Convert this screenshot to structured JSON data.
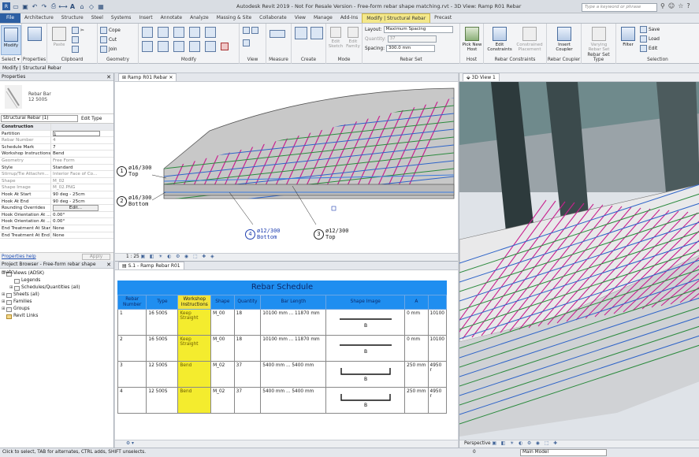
{
  "app": {
    "title": "Autodesk Revit 2019 - Not For Resale Version - Free-form rebar shape matching.rvt - 3D View: Ramp R01 Rebar",
    "search_placeholder": "Type a keyword or phrase"
  },
  "tabs": [
    "File",
    "Architecture",
    "Structure",
    "Steel",
    "Systems",
    "Insert",
    "Annotate",
    "Analyze",
    "Massing & Site",
    "Collaborate",
    "View",
    "Manage",
    "Add-Ins",
    "Modify | Structural Rebar",
    "Precast"
  ],
  "ribbon": {
    "select_label": "Select ▾",
    "modify_label": "Modify",
    "properties_label": "Properties",
    "clipboard_label": "Clipboard",
    "paste_label": "Paste",
    "geometry_label": "Geometry",
    "cope_label": "Cope",
    "cut_label": "Cut",
    "join_label": "Join",
    "modify_group_label": "Modify",
    "view_label": "View",
    "measure_label": "Measure",
    "create_label": "Create",
    "edit_sketch_label": "Edit Sketch",
    "edit_family_label": "Edit Family",
    "mode_label": "Mode",
    "layout_label": "Layout:",
    "layout_value": "Maximum Spacing",
    "quantity_label": "Quantity:",
    "quantity_value": "37",
    "spacing_label": "Spacing:",
    "spacing_value": "300.0 mm",
    "rebar_set_label": "Rebar Set",
    "pick_new_host_label": "Pick New Host",
    "host_label": "Host",
    "edit_constraints_label": "Edit Constraints",
    "constrained_placement_label": "Constrained Placement",
    "rebar_constraints_label": "Rebar Constraints",
    "insert_coupler_label": "Insert Coupler",
    "rebar_coupler_label": "Rebar Coupler",
    "varying_rebar_set_label": "Varying Rebar Set",
    "rebar_set_type_label": "Rebar Set Type",
    "filter_label": "Filter",
    "save_label": "Save",
    "load_label": "Load",
    "edit_label": "Edit",
    "selection_label": "Selection"
  },
  "context_bar": "Modify | Structural Rebar",
  "properties": {
    "header": "Properties",
    "type_line1": "Rebar Bar",
    "type_line2": "12 500S",
    "instance_selector": "Structural Rebar (1)",
    "edit_type": "Edit Type",
    "rows": [
      {
        "k": "Construction",
        "v": "",
        "section": true
      },
      {
        "k": "Partition",
        "v": "1",
        "input": true
      },
      {
        "k": "Rebar Number",
        "v": "4",
        "grey": true
      },
      {
        "k": "Schedule Mark",
        "v": "7"
      },
      {
        "k": "Workshop Instructions",
        "v": "Bend"
      },
      {
        "k": "Geometry",
        "v": "Free Form",
        "grey": true
      },
      {
        "k": "Style",
        "v": "Standard"
      },
      {
        "k": "Stirrup/Tie Attachm...",
        "v": "Interior Face of Co...",
        "grey": true
      },
      {
        "k": "Shape",
        "v": "M_02",
        "grey": true
      },
      {
        "k": "Shape Image",
        "v": "M_02.PNG",
        "grey": true
      },
      {
        "k": "Hook At Start",
        "v": "90 deg - 25cm"
      },
      {
        "k": "Hook At End",
        "v": "90 deg - 25cm"
      },
      {
        "k": "Rounding Overrides",
        "v": "Edit...",
        "button": true
      },
      {
        "k": "Hook Orientation At ...",
        "v": "0.00°"
      },
      {
        "k": "Hook Orientation At ...",
        "v": "0.00°"
      },
      {
        "k": "End Treatment At Start",
        "v": "None"
      },
      {
        "k": "End Treatment At End",
        "v": "None"
      }
    ],
    "help_link": "Properties help",
    "apply": "Apply"
  },
  "project_browser": {
    "header": "Project Browser - Free-form rebar shape matc...",
    "items": [
      {
        "label": "Views (ADSK)",
        "sign": "⊟",
        "indent": 0
      },
      {
        "label": "Legends",
        "sign": "",
        "indent": 1
      },
      {
        "label": "Schedules/Quantities (all)",
        "sign": "⊞",
        "indent": 1
      },
      {
        "label": "Sheets (all)",
        "sign": "⊞",
        "indent": 0
      },
      {
        "label": "Families",
        "sign": "⊞",
        "indent": 0
      },
      {
        "label": "Groups",
        "sign": "⊞",
        "indent": 0
      },
      {
        "label": "Revit Links",
        "sign": "",
        "indent": 0
      }
    ]
  },
  "view1": {
    "tab": "Ramp R01 Rebar",
    "scale": "1 : 25",
    "callouts": [
      {
        "num": "1",
        "l1": "ø16/300",
        "l2": "Top"
      },
      {
        "num": "2",
        "l1": "ø16/300",
        "l2": "Bottom"
      },
      {
        "num": "4",
        "l1": "ø12/300",
        "l2": "Bottom"
      },
      {
        "num": "3",
        "l1": "ø12/300",
        "l2": "Top"
      }
    ]
  },
  "view2": {
    "tab": "S.1 - Ramp Rebar R01",
    "title": "Rebar Schedule",
    "headers": [
      "Rebar Number",
      "Type",
      "Workshop Instructions",
      "Shape",
      "Quantity",
      "Bar Length",
      "Shape Image",
      "A",
      ""
    ],
    "rows": [
      {
        "num": "1",
        "type": "16 500S",
        "instr": "Keep Straight",
        "shape": "M_00",
        "qty": "18",
        "len": "10100 mm ... 11870 mm",
        "label": "B",
        "a": "0 mm",
        "b": "10100"
      },
      {
        "num": "2",
        "type": "16 500S",
        "instr": "Keep Straight",
        "shape": "M_00",
        "qty": "18",
        "len": "10100 mm ... 11870 mm",
        "label": "B",
        "a": "0 mm",
        "b": "10100"
      },
      {
        "num": "3",
        "type": "12 500S",
        "instr": "Bend",
        "shape": "M_02",
        "qty": "37",
        "len": "5400 mm ... 5400 mm",
        "label": "B",
        "a": "250 mm",
        "b": "4950 r"
      },
      {
        "num": "4",
        "type": "12 500S",
        "instr": "Bend",
        "shape": "M_02",
        "qty": "37",
        "len": "5400 mm ... 5400 mm",
        "label": "B",
        "a": "250 mm",
        "b": "4950 r"
      }
    ]
  },
  "view3": {
    "tab": "3D View 1",
    "perspective": "Perspective"
  },
  "status": {
    "text": "Click to select, TAB for alternates, CTRL adds, SHIFT unselects.",
    "zero": "0",
    "model": "Main Model"
  },
  "colors": {
    "file_tab": "#2d5fa3",
    "active_tab": "#f4e88a",
    "schedule_header": "#1f8ef0",
    "workshop_highlight": "#f4ec2e",
    "rebar_magenta": "#c8228f",
    "rebar_green": "#2b8a3e",
    "rebar_blue": "#2e64c8"
  }
}
